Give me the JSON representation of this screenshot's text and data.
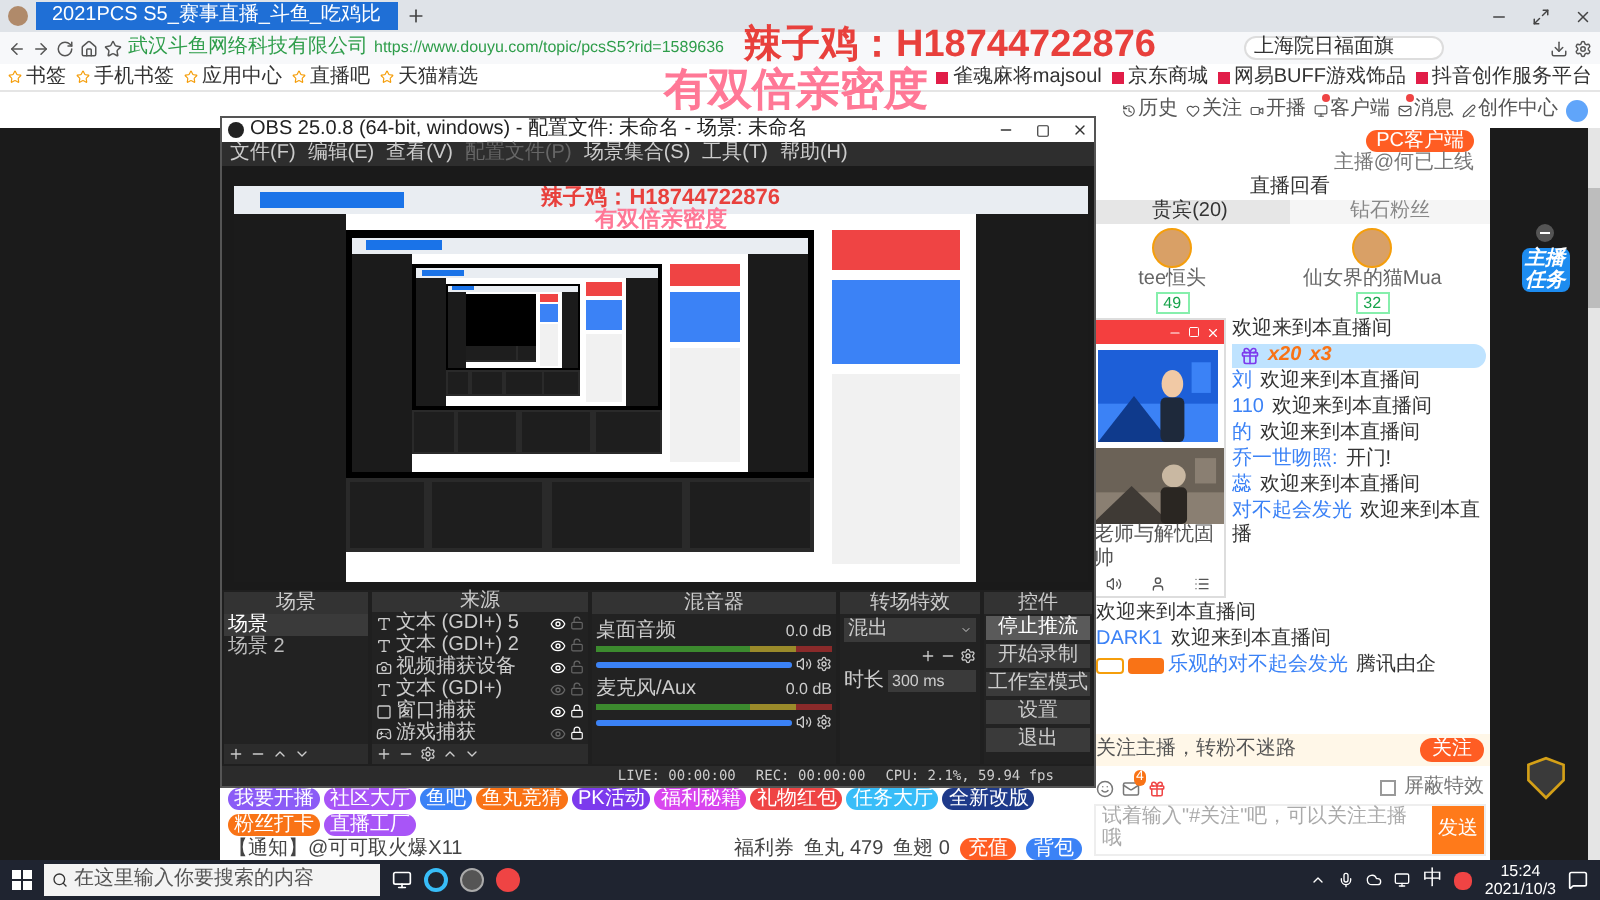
{
  "browser": {
    "tab_title": "2021PCS S5_赛事直播_斗鱼_吃鸡比",
    "site_badge": "武汉斗鱼网络科技有限公司",
    "url": "https://www.douyu.com/topic/pcsS5?rid=1589636",
    "search": "上海院日福面旗",
    "bookmarks": [
      {
        "label": "书签"
      },
      {
        "label": "手机书签"
      },
      {
        "label": "应用中心"
      },
      {
        "label": "直播吧"
      },
      {
        "label": "天猫精选"
      }
    ],
    "bookmarks_right": [
      {
        "label": "雀魂麻将majsoul"
      },
      {
        "label": "京东商城"
      },
      {
        "label": "网易BUFF游戏饰品"
      },
      {
        "label": "抖音创作服务平台"
      }
    ]
  },
  "overlay": [
    "辣子鸡：H18744722876",
    "有双倍亲密度"
  ],
  "site_header": [
    {
      "label": "历史",
      "dot": false
    },
    {
      "label": "关注",
      "dot": false
    },
    {
      "label": "开播",
      "dot": false
    },
    {
      "label": "客户端",
      "dot": true
    },
    {
      "label": "消息",
      "dot": true
    },
    {
      "label": "创作中心",
      "dot": false
    }
  ],
  "obs": {
    "title": "OBS 25.0.8 (64-bit, windows) - 配置文件: 未命名 - 场景: 未命名",
    "menu": [
      {
        "label": "文件(F)",
        "disabled": false
      },
      {
        "label": "编辑(E)",
        "disabled": false
      },
      {
        "label": "查看(V)",
        "disabled": false
      },
      {
        "label": "配置文件(P)",
        "disabled": true
      },
      {
        "label": "场景集合(S)",
        "disabled": false
      },
      {
        "label": "工具(T)",
        "disabled": false
      },
      {
        "label": "帮助(H)",
        "disabled": false
      }
    ],
    "preview": {
      "overlay": [
        "辣子鸡：H18744722876",
        "有双倍亲密度"
      ]
    },
    "scenes": {
      "header": "场景",
      "items": [
        {
          "label": "场景",
          "selected": true
        },
        {
          "label": "场景 2",
          "selected": false
        }
      ]
    },
    "sources": {
      "header": "来源",
      "items": [
        {
          "kind": "text",
          "label": "文本 (GDI+) 5",
          "visible": true,
          "locked": false
        },
        {
          "kind": "text",
          "label": "文本 (GDI+) 2",
          "visible": true,
          "locked": false
        },
        {
          "kind": "camera",
          "label": "视频捕获设备",
          "visible": true,
          "locked": false
        },
        {
          "kind": "text",
          "label": "文本 (GDI+)",
          "visible": false,
          "locked": false
        },
        {
          "kind": "window",
          "label": "窗口捕获",
          "visible": true,
          "locked": true
        },
        {
          "kind": "game",
          "label": "游戏捕获",
          "visible": false,
          "locked": true
        }
      ]
    },
    "mixer": {
      "header": "混音器",
      "channels": [
        {
          "name": "桌面音频",
          "reading": "0.0 dB",
          "level": 1
        },
        {
          "name": "麦克风/Aux",
          "reading": "0.0 dB",
          "level": 1
        }
      ]
    },
    "transitions": {
      "header": "转场特效",
      "value": "混出",
      "duration_label": "时长",
      "duration": "300 ms"
    },
    "controls": {
      "header": "控件",
      "buttons": [
        {
          "label": "停止推流",
          "highlighted": true
        },
        {
          "label": "开始录制",
          "highlighted": false
        },
        {
          "label": "工作室模式",
          "highlighted": false
        },
        {
          "label": "设置",
          "highlighted": false
        },
        {
          "label": "退出",
          "highlighted": false
        }
      ]
    },
    "status": [
      "LIVE: 00:00:00",
      "REC: 00:00:00",
      "CPU: 2.1%, 59.94 fps"
    ]
  },
  "room_bar": {
    "tags": [
      {
        "label": "我要开播",
        "color": "#8b5cf6"
      },
      {
        "label": "社区大厅",
        "color": "#a855f7"
      },
      {
        "label": "鱼吧",
        "color": "#3b82f6"
      },
      {
        "label": "鱼丸竞猜",
        "color": "#f97316"
      },
      {
        "label": "PK活动",
        "color": "#7c3aed"
      },
      {
        "label": "福利秘籍",
        "color": "#d946ef"
      },
      {
        "label": "礼物红包",
        "color": "#ef4444"
      },
      {
        "label": "任务大厅",
        "color": "#38bdf8"
      },
      {
        "label": "全新改版",
        "color": "#1e3a8a"
      },
      {
        "label": "粉丝打卡",
        "color": "#f97316"
      },
      {
        "label": "直播工厂",
        "color": "#a855f7"
      }
    ],
    "notice": "【通知】@可可取火爆X11",
    "coupons": "福利券",
    "fish_balls": "鱼丸 479",
    "fins": "鱼翅 0",
    "recharge": "充值",
    "backpack": "背包"
  },
  "chat": {
    "pc_button": "PC客户端",
    "online": "主播@何已上线",
    "replay": "直播回看",
    "tabs": [
      {
        "label": "贵宾(20)",
        "selected": true
      },
      {
        "label": "钻石粉丝",
        "selected": false
      }
    ],
    "fans": [
      {
        "name": "tee恒头",
        "level": "49"
      },
      {
        "name": "仙女界的猫Mua",
        "level": "32"
      }
    ],
    "popup_caption": "老师与解忧固帅",
    "messages": [
      {
        "kind": "text",
        "text": "欢迎来到本直播间"
      },
      {
        "kind": "gift",
        "count": "x20",
        "times": "x3"
      },
      {
        "kind": "text",
        "user": "刘",
        "text": "欢迎来到本直播间"
      },
      {
        "kind": "text",
        "user": "110",
        "text": "欢迎来到本直播间"
      },
      {
        "kind": "text",
        "user": "的",
        "text": "欢迎来到本直播间"
      },
      {
        "kind": "text",
        "user": "乔一世吻照:",
        "text": "开门!"
      },
      {
        "kind": "text",
        "user": "蕊",
        "text": "欢迎来到本直播间"
      },
      {
        "kind": "text",
        "user": "对不起会发光",
        "text": "欢迎来到本直播"
      }
    ],
    "more_messages": [
      {
        "kind": "text",
        "text": "欢迎来到本直播间"
      },
      {
        "kind": "text",
        "user": "DARK1",
        "text": "欢迎来到本直播间"
      },
      {
        "kind": "badged",
        "user": "乐观的对不起会发光",
        "text": "腾讯由企"
      }
    ],
    "follow_text": "关注主播，转粉不迷路",
    "follow_button": "关注",
    "mail_badge": "4",
    "block_effects": {
      "label": "屏蔽特效",
      "checked": false
    },
    "input_placeholder": "试着输入\"#关注\"吧，可以关注主播哦",
    "send": "发送"
  },
  "task_badge": "主播任务",
  "taskbar": {
    "search_placeholder": "在这里输入你要搜索的内容",
    "ime": "中",
    "time": "15:24",
    "date": "2021/10/3"
  }
}
